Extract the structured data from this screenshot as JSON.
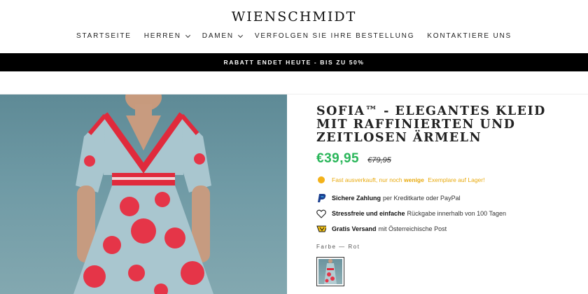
{
  "store": {
    "logo": "WIENSCHMIDT"
  },
  "nav": {
    "items": [
      {
        "label": "STARTSEITE",
        "dropdown": false
      },
      {
        "label": "HERREN",
        "dropdown": true
      },
      {
        "label": "DAMEN",
        "dropdown": true
      },
      {
        "label": "VERFOLGEN SIE IHRE BESTELLUNG",
        "dropdown": false
      },
      {
        "label": "KONTAKTIERE UNS",
        "dropdown": false
      }
    ]
  },
  "banner": {
    "text": "RABATT ENDET HEUTE - BIS ZU 50%"
  },
  "product": {
    "title": "SOFIA™ - ELEGANTES KLEID MIT RAFFINIERTEN UND ZEITLOSEN ÄRMELN",
    "price": "€39,95",
    "old_price": "€79,95",
    "stock": {
      "prefix": "Fast ausverkauft, nur noch",
      "bold": "wenige",
      "suffix": "Exemplare auf Lager!"
    },
    "features": [
      {
        "icon": "paypal-icon",
        "bold": "Sichere Zahlung",
        "text": "per Kreditkarte oder PayPal"
      },
      {
        "icon": "heart-icon",
        "bold": "Stressfreie und einfache",
        "text": "Rückgabe innerhalb von 100 Tagen"
      },
      {
        "icon": "shipping-icon",
        "bold": "Gratis Versand",
        "text": "mit Österreichische Post"
      }
    ],
    "color_label": "Farbe — Rot"
  },
  "colors": {
    "price_green": "#2ab65a",
    "stock_orange": "#e8a90c",
    "banner_bg": "#000000"
  }
}
